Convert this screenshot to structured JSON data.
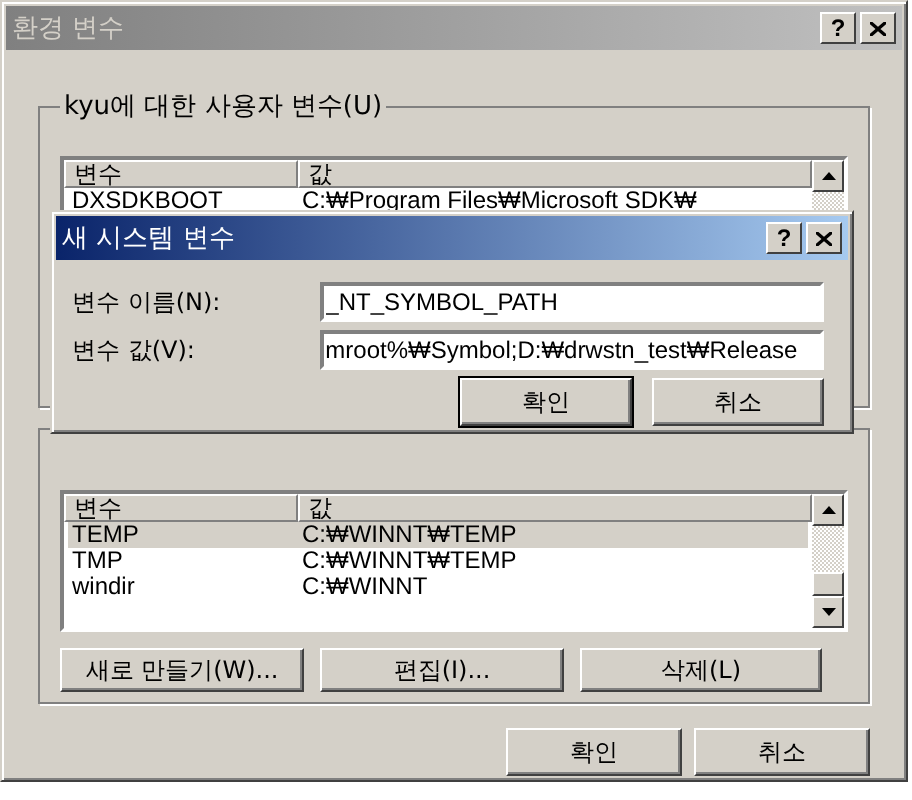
{
  "window": {
    "title": "환경 변수",
    "help_button": "?"
  },
  "user_variables": {
    "label": "kyu에 대한 사용자 변수(U)",
    "columns": [
      "변수",
      "값"
    ],
    "rows": [
      {
        "name": "DXSDKBOOT",
        "value": "C:₩Program Files₩Microsoft SDK₩",
        "selected": false
      }
    ]
  },
  "system_variables": {
    "columns": [
      "변수",
      "값"
    ],
    "rows": [
      {
        "name": "TEMP",
        "value": "C:₩WINNT₩TEMP",
        "selected": true
      },
      {
        "name": "TMP",
        "value": "C:₩WINNT₩TEMP",
        "selected": false
      },
      {
        "name": "windir",
        "value": "C:₩WINNT",
        "selected": false
      }
    ],
    "buttons": [
      "새로 만들기(W)...",
      "편집(I)...",
      "삭제(L)"
    ]
  },
  "buttons": [
    {
      "label": "확인",
      "default": false
    },
    {
      "label": "취소",
      "default": false
    }
  ],
  "dialog": {
    "title": "새 시스템 변수",
    "help_button": "?",
    "fields": [
      {
        "label": "변수 이름(N):",
        "value": "_NT_SYMBOL_PATH"
      },
      {
        "label": "변수 값(V):",
        "value": "mroot%₩Symbol;D:₩drwstn_test₩Release"
      }
    ],
    "buttons": [
      {
        "label": "확인",
        "default": true
      },
      {
        "label": "취소",
        "default": false
      }
    ]
  }
}
